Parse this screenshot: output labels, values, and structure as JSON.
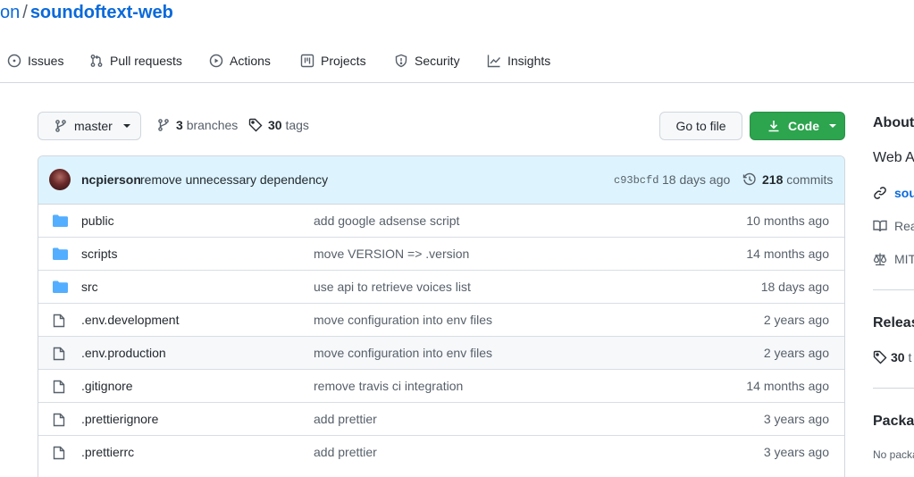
{
  "repo": {
    "owner": "on",
    "separator": "/",
    "name": "soundoftext-web"
  },
  "nav": [
    {
      "label": "Issues",
      "icon": "issue-opened-icon"
    },
    {
      "label": "Pull requests",
      "icon": "git-pull-request-icon"
    },
    {
      "label": "Actions",
      "icon": "play-icon"
    },
    {
      "label": "Projects",
      "icon": "table-icon"
    },
    {
      "label": "Security",
      "icon": "shield-icon"
    },
    {
      "label": "Insights",
      "icon": "graph-icon"
    }
  ],
  "toolbar": {
    "branch": "master",
    "branches_count": "3",
    "branches_label": "branches",
    "tags_count": "30",
    "tags_label": "tags",
    "go_to_file": "Go to file",
    "code": "Code"
  },
  "latest_commit": {
    "author": "ncpierson",
    "message": "remove unnecessary dependency",
    "sha": "c93bcfd",
    "time": "18 days ago",
    "commits_count": "218",
    "commits_label": "commits"
  },
  "files": [
    {
      "type": "dir",
      "name": "public",
      "message": "add google adsense script",
      "time": "10 months ago"
    },
    {
      "type": "dir",
      "name": "scripts",
      "message": "move VERSION => .version",
      "time": "14 months ago"
    },
    {
      "type": "dir",
      "name": "src",
      "message": "use api to retrieve voices list",
      "time": "18 days ago"
    },
    {
      "type": "file",
      "name": ".env.development",
      "message": "move configuration into env files",
      "time": "2 years ago"
    },
    {
      "type": "file",
      "name": ".env.production",
      "message": "move configuration into env files",
      "time": "2 years ago"
    },
    {
      "type": "file",
      "name": ".gitignore",
      "message": "remove travis ci integration",
      "time": "14 months ago"
    },
    {
      "type": "file",
      "name": ".prettierignore",
      "message": "add prettier",
      "time": "3 years ago"
    },
    {
      "type": "file",
      "name": ".prettierrc",
      "message": "add prettier",
      "time": "3 years ago"
    }
  ],
  "sidebar": {
    "about_title": "About",
    "description": "Web A",
    "link": "sou",
    "readme": "Rea",
    "license": "MIT",
    "releases_title": "Releas",
    "releases_count": "30",
    "releases_rest": "t",
    "packages_title": "Packag",
    "packages_text": "No packa"
  },
  "colors": {
    "link": "#0969da",
    "green_button": "#2da44e",
    "commit_bar": "#ddf4ff",
    "folder": "#54aeff",
    "border": "#d0d7de"
  }
}
